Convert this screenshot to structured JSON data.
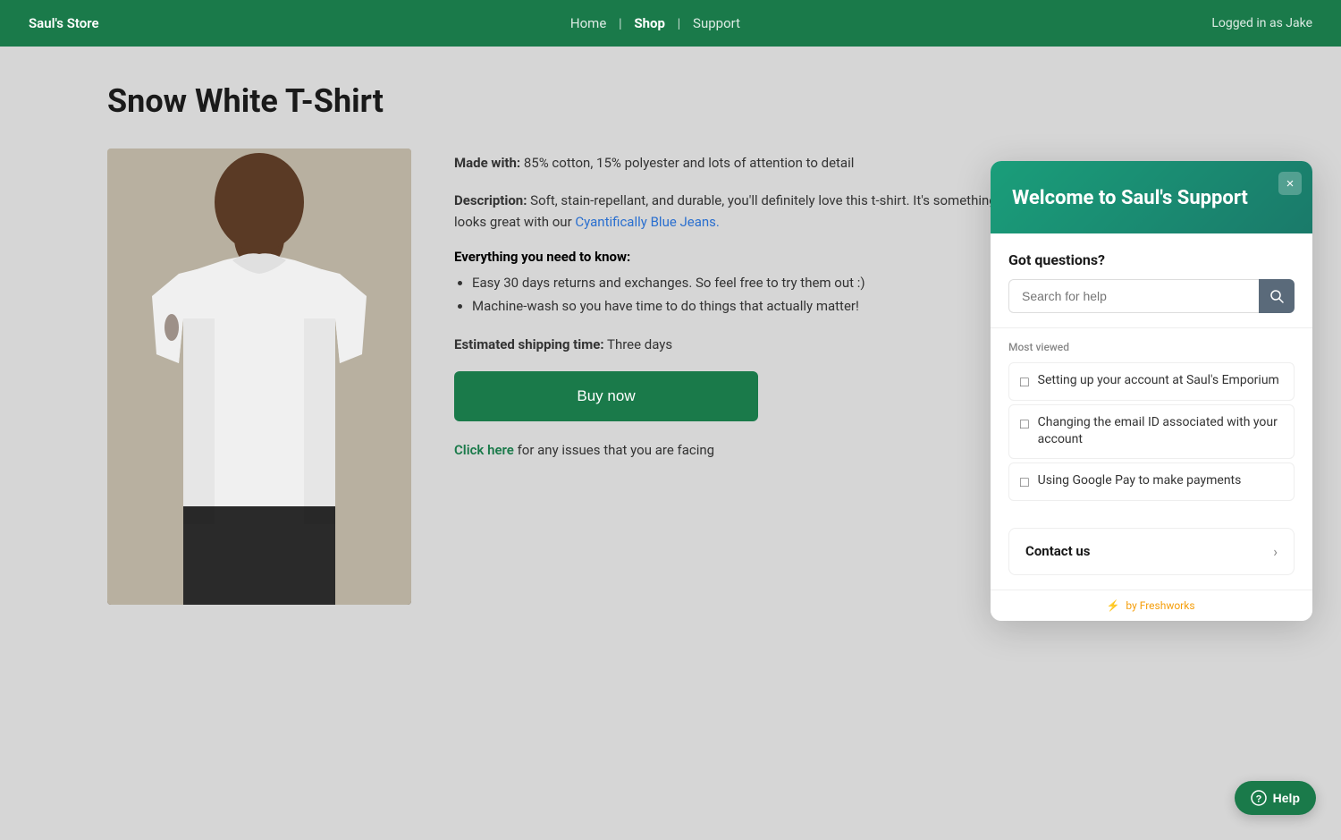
{
  "navbar": {
    "brand": "Saul's Store",
    "links": [
      {
        "label": "Home",
        "active": false
      },
      {
        "label": "Shop",
        "active": true
      },
      {
        "label": "Support",
        "active": false
      }
    ],
    "user_status": "Logged in as Jake"
  },
  "product": {
    "title": "Snow White T-Shirt",
    "made_with_label": "Made with:",
    "made_with_value": "85% cotton, 15% polyester and lots of attention to detail",
    "description_label": "Description:",
    "description_value": "Soft, stain-repellant, and durable, you'll definitely love this t-shirt. It's something you can wear for any occasion, and it looks great with our",
    "description_link_text": "Cyantifically Blue Jeans.",
    "details_heading": "Everything you need to know:",
    "bullets": [
      "Easy 30 days returns and exchanges. So feel free to try them out :)",
      "Machine-wash so you have time to do things that actually matter!"
    ],
    "shipping_label": "Estimated shipping time:",
    "shipping_value": "Three days",
    "buy_button": "Buy now",
    "issues_prefix": "for any issues that you are facing",
    "click_here": "Click here"
  },
  "support_widget": {
    "close_label": "×",
    "header_title": "Welcome to Saul's Support",
    "got_questions": "Got questions?",
    "search_placeholder": "Search for help",
    "most_viewed_label": "Most viewed",
    "articles": [
      {
        "id": 1,
        "text": "Setting up your account at Saul's Emporium"
      },
      {
        "id": 2,
        "text": "Changing the email ID associated with your account"
      },
      {
        "id": 3,
        "text": "Using Google Pay to make payments"
      }
    ],
    "contact_us_label": "Contact us",
    "footer_text": "by Freshworks",
    "footer_icon": "⚡"
  },
  "help_fab": {
    "label": "Help",
    "icon": "?"
  }
}
